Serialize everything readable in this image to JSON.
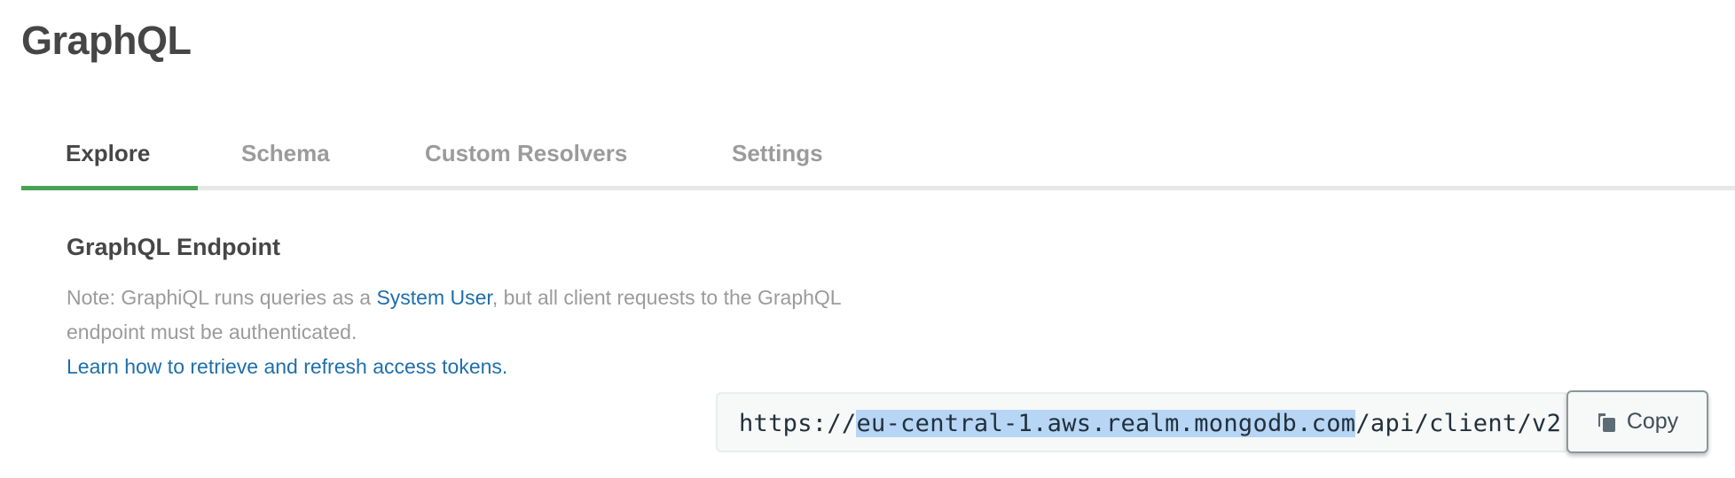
{
  "page": {
    "title": "GraphQL"
  },
  "tabs": [
    {
      "label": "Explore",
      "active": true
    },
    {
      "label": "Schema",
      "active": false
    },
    {
      "label": "Custom Resolvers",
      "active": false
    },
    {
      "label": "Settings",
      "active": false
    }
  ],
  "endpoint": {
    "heading": "GraphQL Endpoint",
    "note_prefix": "Note: GraphiQL runs queries as a ",
    "note_link": "System User",
    "note_suffix": ", but all client requests to the GraphQL endpoint must be authenticated.",
    "learn_link": "Learn how to retrieve and refresh access tokens.",
    "url_prefix": "https://",
    "url_selected": "eu-central-1.aws.realm.mongodb.com",
    "url_suffix": "/api/client/v2",
    "copy_label": "Copy",
    "copy_icon": "copy-icon"
  },
  "colors": {
    "accent": "#4aa153",
    "link": "#1f6fab",
    "selection": "#b7d5f5"
  }
}
